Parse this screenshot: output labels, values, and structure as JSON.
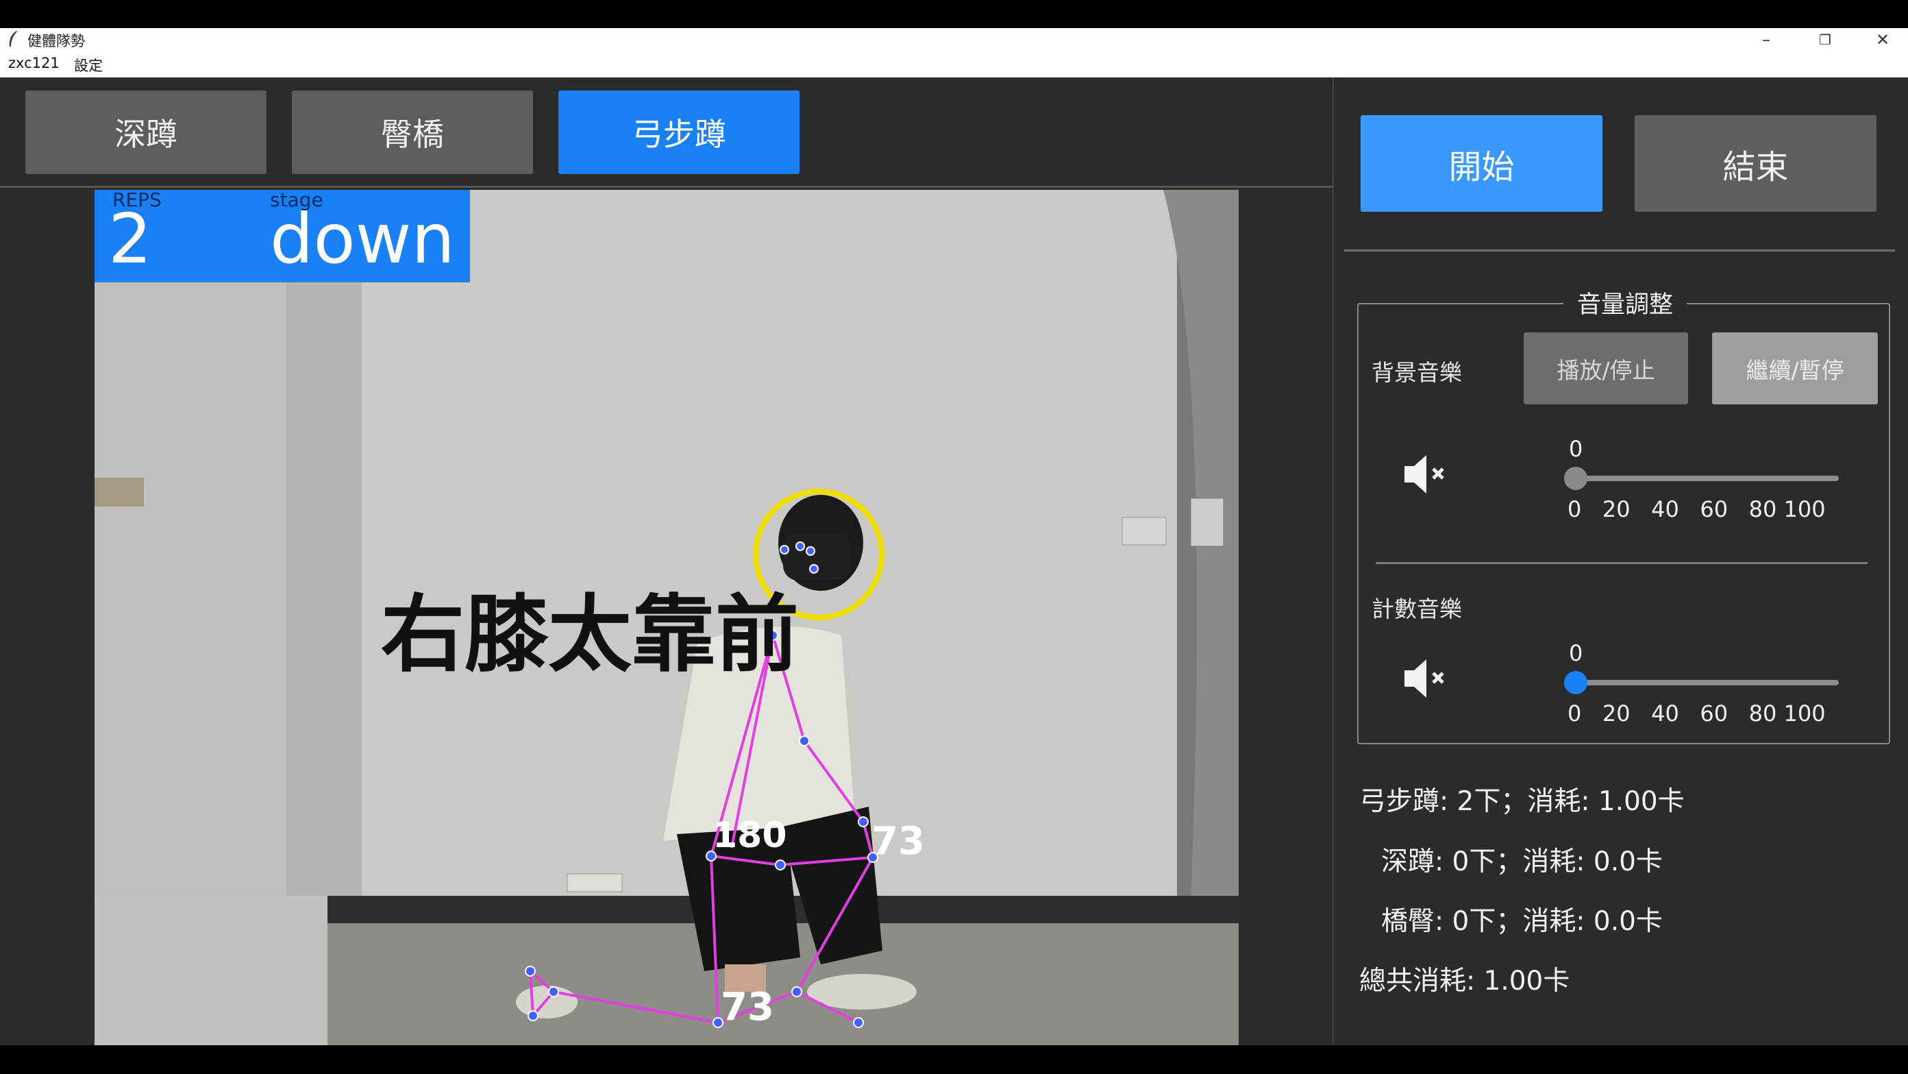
{
  "window": {
    "title": "健體隊勢",
    "controls": {
      "minimize": "–",
      "maximize": "❐",
      "close": "✕"
    }
  },
  "menu": [
    "zxc121",
    "設定"
  ],
  "tabs": [
    {
      "label": "深蹲",
      "active": false
    },
    {
      "label": "臀橋",
      "active": false
    },
    {
      "label": "弓步蹲",
      "active": true
    }
  ],
  "camera": {
    "reps_label": "REPS",
    "reps_value": "2",
    "stage_label": "stage",
    "stage_value": "down",
    "warning": "右膝太靠前",
    "angle_hip": "180",
    "angle_knee_front": "73",
    "angle_knee_back": "73"
  },
  "controls": {
    "start": "開始",
    "stop": "結束"
  },
  "volume": {
    "title": "音量調整",
    "bg": {
      "label": "背景音樂",
      "play_stop": "播放/停止",
      "resume_pause": "繼續/暫停",
      "value": "0",
      "level": 0,
      "icon": "speaker-muted-icon",
      "knob_color": "#8a8a8a"
    },
    "count": {
      "label": "計數音樂",
      "value": "0",
      "level": 0,
      "icon": "speaker-muted-icon",
      "knob_color": "#1a80f5"
    },
    "ticks": [
      "0",
      "20",
      "40",
      "60",
      "80",
      "100"
    ]
  },
  "stats": [
    "弓步蹲: 2下；消耗: 1.00卡",
    "深蹲: 0下；消耗: 0.0卡",
    "橋臀: 0下；消耗: 0.0卡",
    "總共消耗: 1.00卡"
  ],
  "colors": {
    "accent": "#1a80f5",
    "skeleton": "#e040e0",
    "joint": "#4060ff",
    "face_ring": "#f0e000"
  }
}
